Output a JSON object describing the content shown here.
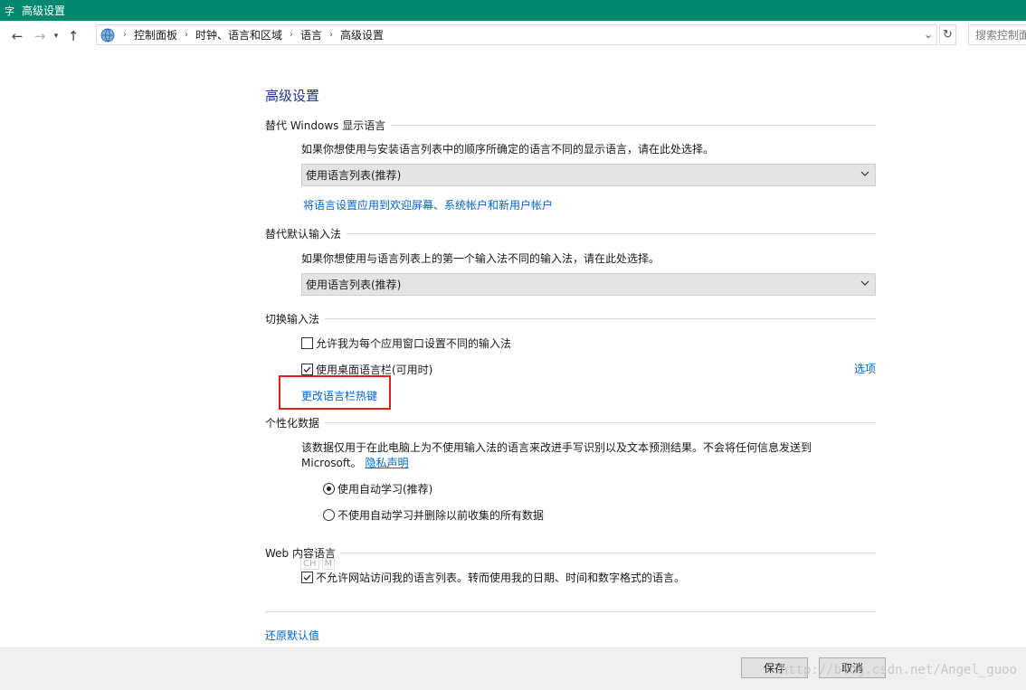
{
  "window": {
    "title": "高级设置"
  },
  "nav": {
    "breadcrumbs": [
      "控制面板",
      "时钟、语言和区域",
      "语言",
      "高级设置"
    ],
    "search_placeholder": "搜索控制面板"
  },
  "page": {
    "title": "高级设置"
  },
  "sections": {
    "display_lang": {
      "label": "替代 Windows 显示语言",
      "desc": "如果你想使用与安装语言列表中的顺序所确定的语言不同的显示语言，请在此处选择。",
      "select_value": "使用语言列表(推荐)",
      "apply_link": "将语言设置应用到欢迎屏幕、系统帐户和新用户帐户"
    },
    "default_input": {
      "label": "替代默认输入法",
      "desc": "如果你想使用与语言列表上的第一个输入法不同的输入法，请在此处选择。",
      "select_value": "使用语言列表(推荐)"
    },
    "switch_input": {
      "label": "切换输入法",
      "per_app_checkbox": {
        "label": "允许我为每个应用窗口设置不同的输入法",
        "checked": false
      },
      "langbar_checkbox": {
        "label": "使用桌面语言栏(可用时)",
        "checked": true
      },
      "options_link": "选项",
      "hotkey_link": "更改语言栏热键"
    },
    "personalization": {
      "label": "个性化数据",
      "desc_line1": "该数据仅用于在此电脑上为不使用输入法的语言来改进手写识别以及文本预测结果。不会将任何信息发送到",
      "desc_line2": "Microsoft。",
      "privacy_link": "隐私声明",
      "radio_auto": {
        "label": "使用自动学习(推荐)",
        "selected": true
      },
      "radio_no_auto": {
        "label": "不使用自动学习并删除以前收集的所有数据",
        "selected": false
      }
    },
    "web_lang": {
      "label": "Web 内容语言",
      "ime_tag": [
        "CH",
        "M"
      ],
      "checkbox": {
        "label": "不允许网站访问我的语言列表。转而使用我的日期、时间和数字格式的语言。",
        "checked": true
      }
    }
  },
  "restore_link": "还原默认值",
  "footer": {
    "save_label": "保存",
    "cancel_label": "取消",
    "watermark": "http://blog.csdn.net/Angel_guoo"
  },
  "colors": {
    "titlebar": "#00896f",
    "link": "#0066cc",
    "highlight": "#e0201c"
  }
}
